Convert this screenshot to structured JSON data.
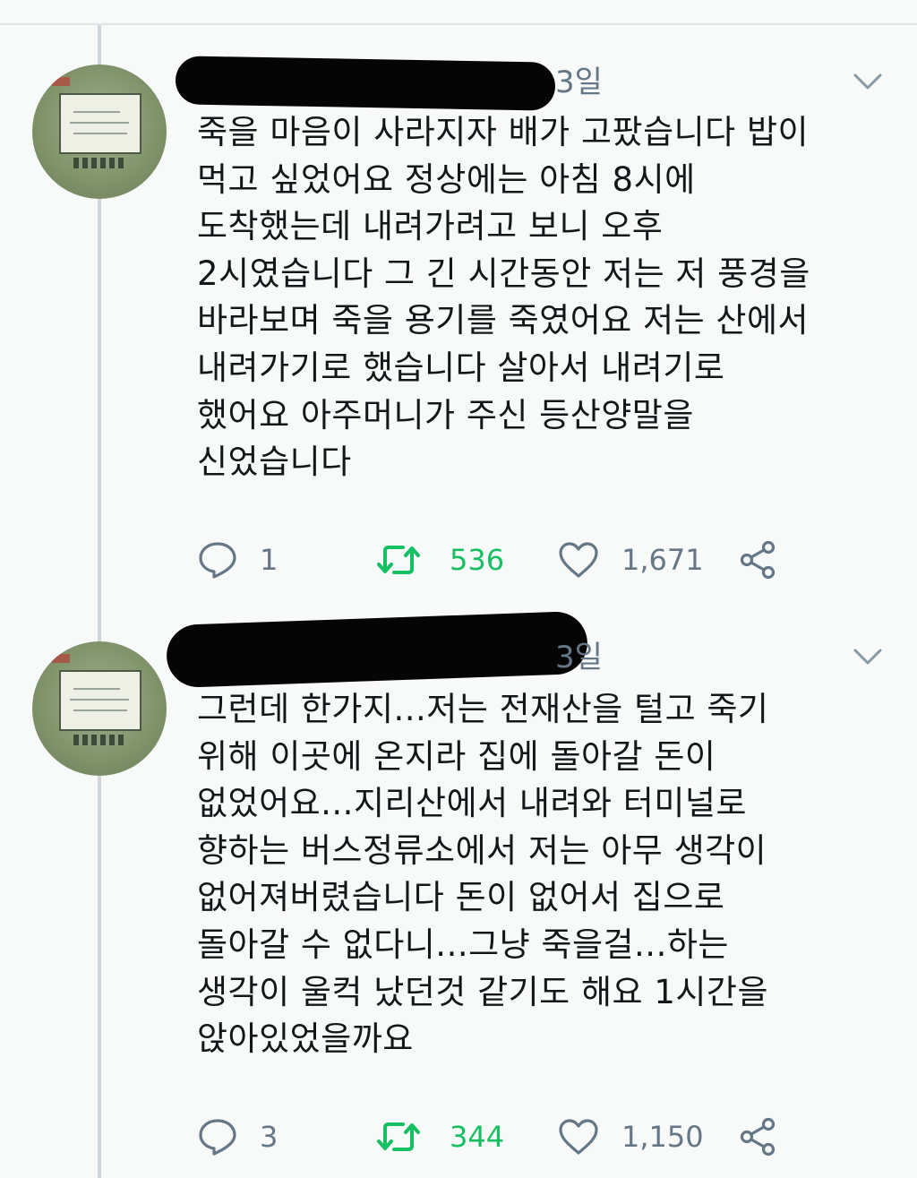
{
  "tweets": [
    {
      "time": "3일",
      "lines": [
        "죽을 마음이 사라지자 배가 고팠습니다 밥이",
        "먹고 싶었어요 정상에는 아침 8시에",
        "도착했는데 내려가려고 보니 오후",
        "2시였습니다 그 긴 시간동안 저는 저 풍경을",
        "바라보며 죽을 용기를 죽였어요 저는 산에서",
        "내려가기로 했습니다 살아서 내려기로",
        "했어요 아주머니가 주신 등산양말을",
        "신었습니다"
      ],
      "replies": "1",
      "retweets": "536",
      "likes": "1,671"
    },
    {
      "time": "3일",
      "lines": [
        "그런데 한가지...저는 전재산을 털고 죽기",
        "위해 이곳에 온지라 집에 돌아갈 돈이",
        "없었어요...지리산에서 내려와 터미널로",
        "향하는 버스정류소에서 저는 아무 생각이",
        "없어져버렸습니다 돈이 없어서 집으로",
        "돌아갈 수 없다니...그냥 죽을걸...하는",
        "생각이 울컥 났던것 같기도 해요 1시간을",
        "앉아있었을까요"
      ],
      "replies": "3",
      "retweets": "344",
      "likes": "1,150"
    }
  ],
  "colors": {
    "text": "#14171a",
    "secondary": "#657786",
    "retweet": "#17bf63",
    "thread_line": "#cfd6dc",
    "background": "#f8f9f9"
  },
  "icons": [
    "reply-icon",
    "retweet-icon",
    "like-icon",
    "share-icon",
    "chevron-down-icon"
  ]
}
